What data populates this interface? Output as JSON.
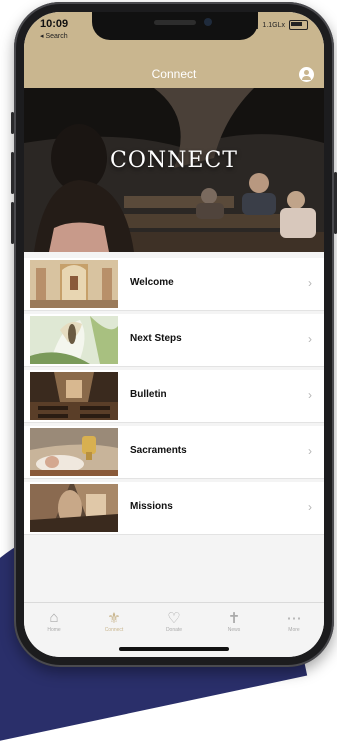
{
  "status": {
    "time": "10:09",
    "back_label": "◂ Search",
    "carrier": "1.1GLx",
    "signal_icon": "signal-icon",
    "battery_icon": "battery-icon"
  },
  "nav": {
    "title": "Connect",
    "profile_icon": "profile-icon"
  },
  "hero": {
    "title": "CONNECT"
  },
  "items": [
    {
      "label": "Welcome",
      "icon": "chevron-right-icon"
    },
    {
      "label": "Next Steps",
      "icon": "chevron-right-icon"
    },
    {
      "label": "Bulletin",
      "icon": "chevron-right-icon"
    },
    {
      "label": "Sacraments",
      "icon": "chevron-right-icon"
    },
    {
      "label": "Missions",
      "icon": "chevron-right-icon"
    }
  ],
  "tabs": [
    {
      "label": "Home",
      "icon": "home-icon",
      "active": false
    },
    {
      "label": "Connect",
      "icon": "connect-icon",
      "active": true
    },
    {
      "label": "Donate",
      "icon": "heart-icon",
      "active": false
    },
    {
      "label": "News",
      "icon": "cross-icon",
      "active": false
    },
    {
      "label": "More",
      "icon": "more-icon",
      "active": false
    }
  ],
  "colors": {
    "accent": "#c9b68f",
    "tab_inactive": "#aaaaaa",
    "background_shape": "#2a2f6a"
  }
}
